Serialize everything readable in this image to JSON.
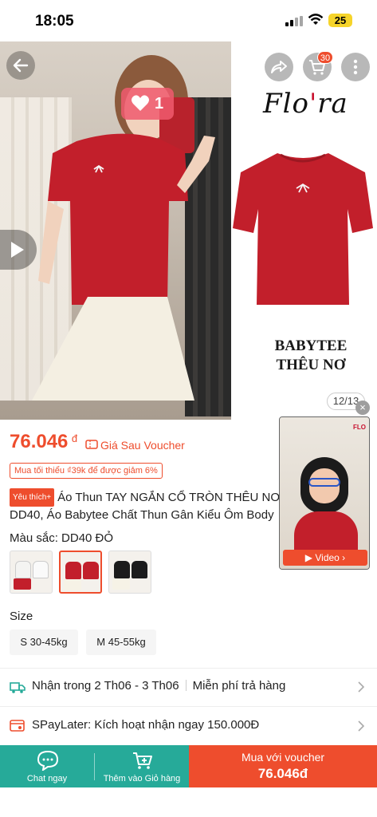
{
  "status_bar": {
    "time": "18:05",
    "battery": "25"
  },
  "hero": {
    "cart_count": "30",
    "like_count": "1",
    "brand_logo": "Flo'ra",
    "banner_text_line1": "BABYTEE",
    "banner_text_line2": "THÊU NƠ",
    "image_counter": "12/13"
  },
  "price": {
    "amount": "76.046",
    "currency": "đ",
    "voucher_label": "Giá Sau Voucher",
    "voucher_condition": "Mua tối thiểu ₫39k để được giảm 6%"
  },
  "product": {
    "favorite_badge": "Yêu thích+",
    "title": "Áo Thun TAY NGẮN CỔ TRÒN THÊU NƠ DD40, Áo Babytee Chất Thun Gân Kiểu Ôm Body"
  },
  "variants": {
    "color_label": "Màu sắc: DD40 ĐỎ",
    "size_label": "Size",
    "sizes": [
      "S 30-45kg",
      "M 45-55kg"
    ]
  },
  "shipping": {
    "delivery": "Nhận trong 2 Th06 - 3 Th06",
    "returns": "Miễn phí trả hàng"
  },
  "spaylater": {
    "text": "SPayLater: Kích hoạt nhận ngay 150.000Đ"
  },
  "video": {
    "button_label": "Video",
    "close": "×",
    "brand": "FLO"
  },
  "bottom_bar": {
    "chat_label": "Chat ngay",
    "cart_label": "Thêm vào Giỏ hàng",
    "buy_line1": "Mua với voucher",
    "buy_line2": "76.046đ"
  },
  "colors": {
    "accent": "#ee4d2d",
    "chat_green": "#26aa99",
    "shirt_red": "#c21f2b"
  }
}
